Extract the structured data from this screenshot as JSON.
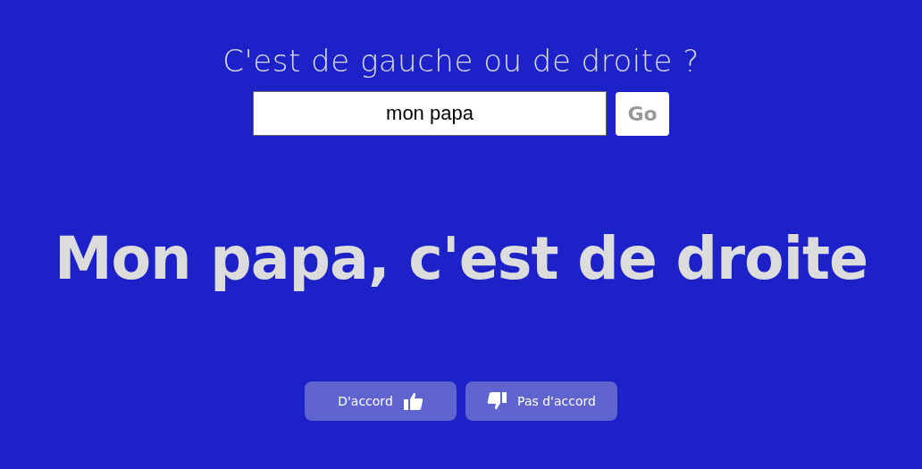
{
  "heading": "C'est de gauche ou de droite ?",
  "search": {
    "value": "mon papa",
    "button": "Go"
  },
  "verdict": "Mon papa, c'est de droite",
  "votes": [
    {
      "label": "D'accord",
      "kind": "agree"
    },
    {
      "label": "Pas d'accord",
      "kind": "disagree"
    }
  ]
}
